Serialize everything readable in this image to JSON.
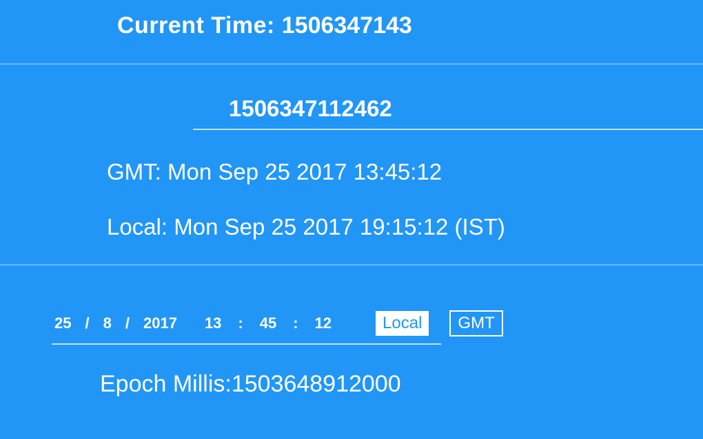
{
  "header": {
    "label": "Current Time: ",
    "value": "1506347143"
  },
  "conversion": {
    "input_timestamp": "1506347112462",
    "gmt_label": "GMT: ",
    "gmt_value": "Mon Sep 25 2017 13:45:12",
    "local_label": "Local: ",
    "local_value": "Mon Sep 25 2017 19:15:12 (IST)"
  },
  "builder": {
    "day": "25",
    "month": "8",
    "year": "2017",
    "hour": "13",
    "minute": "45",
    "second": "12",
    "local_btn": "Local",
    "gmt_btn": "GMT",
    "epoch_label": "Epoch Millis:",
    "epoch_value": "1503648912000"
  }
}
